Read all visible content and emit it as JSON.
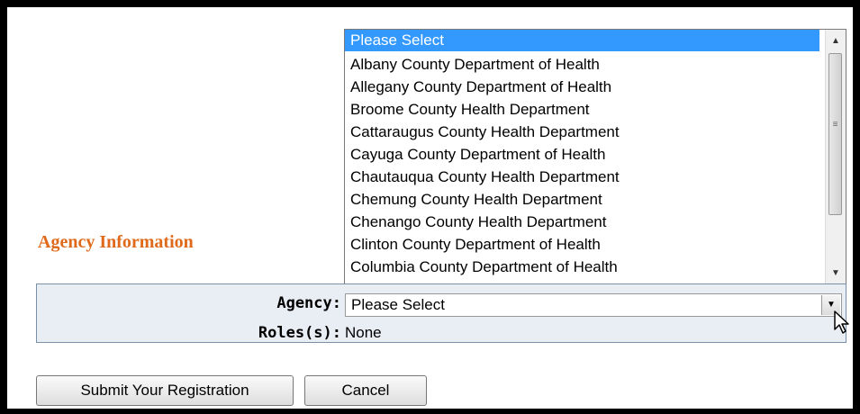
{
  "dropdown": {
    "items": [
      "Please Select",
      "Albany County Department of Health",
      "Allegany County Department of Health",
      "Broome County Health Department",
      "Cattaraugus County Health Department",
      "Cayuga County Department of Health",
      "Chautauqua County Health Department",
      "Chemung County Health Department",
      "Chenango County Health Department",
      "Clinton County Department of Health",
      "Columbia County Department of Health"
    ],
    "selected_index": 0,
    "selection_color": "#3399ff",
    "scroll_up_icon": "triangle-up-icon",
    "scroll_down_icon": "triangle-down-icon"
  },
  "section": {
    "heading": "Agency Information",
    "heading_color": "#e06a1b"
  },
  "form": {
    "agency_label": "Agency:",
    "agency_value": "Please Select",
    "roles_label": "Roles(s):",
    "roles_value": "None",
    "panel_color": "#e9eef5"
  },
  "buttons": {
    "submit_label": "Submit Your Registration",
    "cancel_label": "Cancel"
  }
}
